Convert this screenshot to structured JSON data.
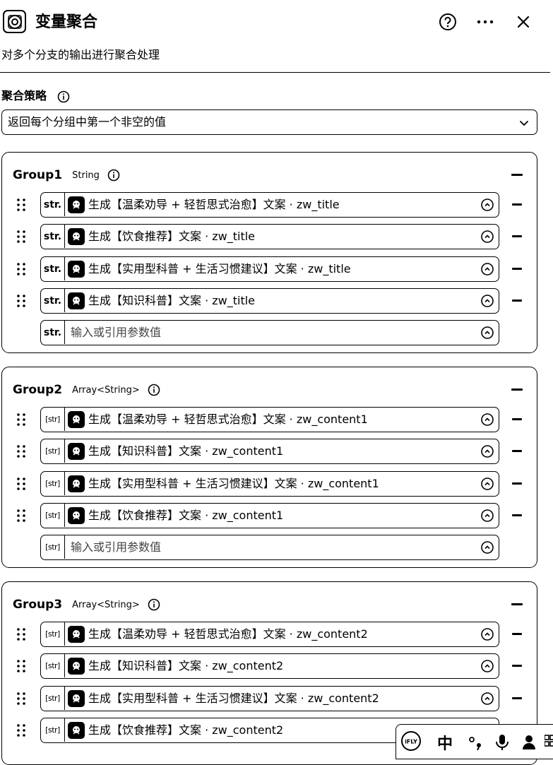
{
  "header": {
    "title": "变量聚合",
    "description": "对多个分支的输出进行聚合处理",
    "icons": [
      "node-icon",
      "help-icon",
      "more-icon",
      "close-icon"
    ]
  },
  "strategy": {
    "label": "聚合策略",
    "selected": "返回每个分组中第一个非空的值"
  },
  "groups": [
    {
      "name": "Group1",
      "type": "String",
      "tag": "str.",
      "items": [
        "生成【温柔劝导 + 轻哲思式治愈】文案 · zw_title",
        "生成【饮食推荐】文案 · zw_title",
        "生成【实用型科普 + 生活习惯建议】文案 · zw_title",
        "生成【知识科普】文案 · zw_title"
      ],
      "placeholder": "输入或引用参数值"
    },
    {
      "name": "Group2",
      "type": "Array<String>",
      "tag": "[str]",
      "items": [
        "生成【温柔劝导 + 轻哲思式治愈】文案 · zw_content1",
        "生成【知识科普】文案 · zw_content1",
        "生成【实用型科普 + 生活习惯建议】文案 · zw_content1",
        "生成【饮食推荐】文案 · zw_content1"
      ],
      "placeholder": "输入或引用参数值"
    },
    {
      "name": "Group3",
      "type": "Array<String>",
      "tag": "[str]",
      "items": [
        "生成【温柔劝导 + 轻哲思式治愈】文案 · zw_content2",
        "生成【知识科普】文案 · zw_content2",
        "生成【实用型科普 + 生活习惯建议】文案 · zw_content2",
        "生成【饮食推荐】文案 · zw_content2"
      ]
    }
  ],
  "ime": {
    "logo": "iFLY",
    "mode": "中",
    "icons": [
      "punctuation-icon",
      "microphone-icon",
      "user-icon",
      "grid-icon"
    ]
  }
}
